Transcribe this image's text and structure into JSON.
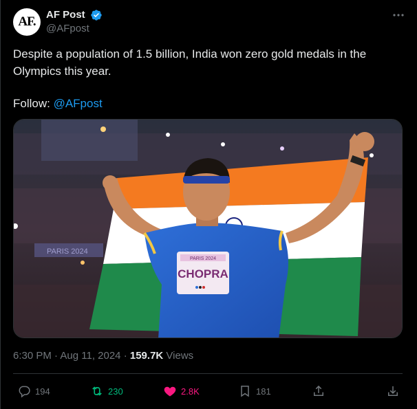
{
  "author": {
    "avatar_text": "AF.",
    "display_name": "AF Post",
    "handle": "@AFpost",
    "verified": true
  },
  "tweet": {
    "text_line1": "Despite a population of 1.5 billion, India won zero gold medals in the",
    "text_line2": "Olympics this year.",
    "follow_label": "Follow: ",
    "follow_link": "@AFpost"
  },
  "media": {
    "description": "photo",
    "bib_event": "PARIS 2024",
    "bib_name": "CHOPRA",
    "banner_text": "PARIS 2024"
  },
  "meta": {
    "time": "6:30 PM",
    "separator": " · ",
    "date": "Aug 11, 2024",
    "separator2": " · ",
    "views_count": "159.7K",
    "views_label": " Views"
  },
  "actions": {
    "reply_count": "194",
    "retweet_count": "230",
    "like_count": "2.8K",
    "bookmark_count": "181"
  },
  "colors": {
    "accent": "#1d9bf0",
    "retweet": "#00ba7c",
    "like": "#f91880",
    "muted": "#71767b"
  }
}
